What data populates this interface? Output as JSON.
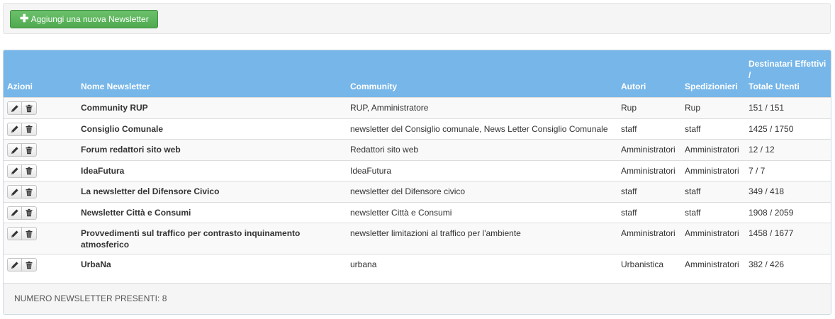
{
  "toolbar": {
    "add_label": "Aggiungi una nuova Newsletter"
  },
  "table": {
    "headers": {
      "actions": "Azioni",
      "name": "Nome Newsletter",
      "community": "Community",
      "authors": "Autori",
      "senders": "Spedizionieri",
      "dest_line1": "Destinatari Effettivi",
      "dest_line2": "/",
      "dest_line3": "Totale Utenti"
    },
    "rows": [
      {
        "name": "Community RUP",
        "community": "RUP, Amministratore",
        "authors": "Rup",
        "senders": "Rup",
        "recipients": "151 / 151"
      },
      {
        "name": "Consiglio Comunale",
        "community": "newsletter del Consiglio comunale, News Letter Consiglio Comunale",
        "authors": "staff",
        "senders": "staff",
        "recipients": "1425 / 1750"
      },
      {
        "name": "Forum redattori sito web",
        "community": "Redattori sito web",
        "authors": "Amministratori",
        "senders": "Amministratori",
        "recipients": "12 / 12"
      },
      {
        "name": "IdeaFutura",
        "community": "IdeaFutura",
        "authors": "Amministratori",
        "senders": "Amministratori",
        "recipients": "7 / 7"
      },
      {
        "name": "La newsletter del Difensore Civico",
        "community": "newsletter del Difensore civico",
        "authors": "staff",
        "senders": "staff",
        "recipients": "349 / 418"
      },
      {
        "name": "Newsletter Città e Consumi",
        "community": "newsletter Città e Consumi",
        "authors": "staff",
        "senders": "staff",
        "recipients": "1908 / 2059"
      },
      {
        "name": "Provvedimenti sul traffico per contrasto inquinamento atmosferico",
        "community": "newsletter limitazioni al traffico per l'ambiente",
        "authors": "Amministratori",
        "senders": "Amministratori",
        "recipients": "1458 / 1677"
      },
      {
        "name": "UrbaNa",
        "community": "urbana",
        "authors": "Urbanistica",
        "senders": "Amministratori",
        "recipients": "382 / 426"
      }
    ]
  },
  "footer": {
    "count_label": "NUMERO NEWSLETTER PRESENTI: 8"
  },
  "colors": {
    "header_bg": "#76b6e9",
    "add_button": "#5cb85c"
  },
  "icons": {
    "add": "plus-icon",
    "edit": "pencil-icon",
    "delete": "trash-icon"
  }
}
